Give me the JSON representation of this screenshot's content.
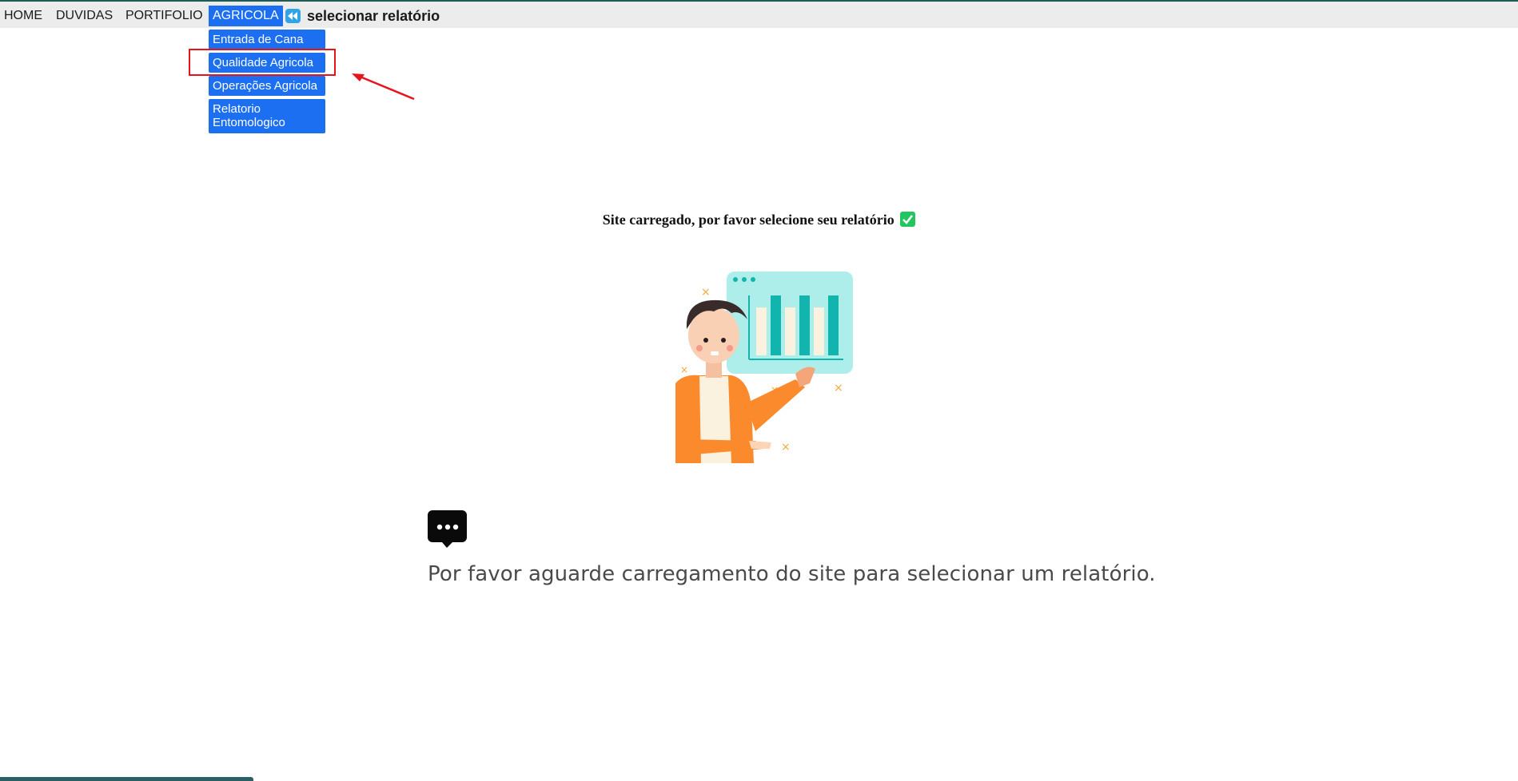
{
  "navbar": {
    "items": [
      {
        "label": "HOME"
      },
      {
        "label": "DUVIDAS"
      },
      {
        "label": "PORTIFOLIO"
      },
      {
        "label": "AGRICOLA"
      }
    ],
    "back_icon": "rewind-icon",
    "title": "selecionar relatório"
  },
  "dropdown": {
    "items": [
      {
        "label": "Entrada de Cana"
      },
      {
        "label": "Qualidade Agricola"
      },
      {
        "label": "Operações Agricola"
      },
      {
        "label": "Relatorio Entomologico"
      }
    ],
    "highlighted": "Qualidade Agricola"
  },
  "main": {
    "loaded_message": "Site carregado, por favor selecione seu relatório",
    "check_icon": "check-box-icon",
    "illustration": "person-presenting-chart",
    "chat_icon": "chat-bubble-ellipsis-icon",
    "wait_message": "Por favor aguarde carregamento do site para selecionar um relatório."
  },
  "colors": {
    "nav_bg": "#ececec",
    "accent_blue": "#1d6ff2",
    "highlight_red": "#e8141c",
    "check_green": "#22c55e"
  }
}
